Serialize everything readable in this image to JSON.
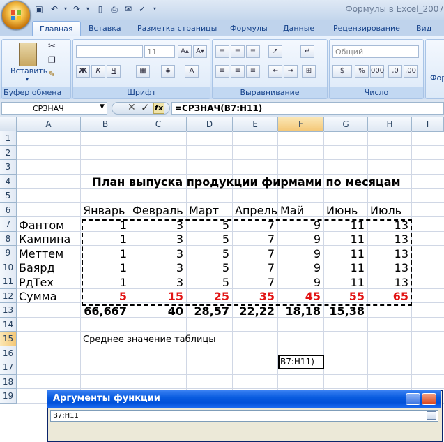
{
  "window": {
    "title": "Формулы в Excel_2007"
  },
  "tabs": [
    "Главная",
    "Вставка",
    "Разметка страницы",
    "Формулы",
    "Данные",
    "Рецензирование",
    "Вид"
  ],
  "ribbon": {
    "clipboard": {
      "label": "Буфер обмена",
      "paste": "Вставить"
    },
    "font": {
      "label": "Шрифт",
      "size": "11",
      "bold": "Ж",
      "italic": "К",
      "underline": "Ч"
    },
    "alignment": {
      "label": "Выравнивание"
    },
    "number": {
      "label": "Число",
      "format": "Общий"
    },
    "styles": {
      "label": "Фор"
    }
  },
  "formula_bar": {
    "name_box": "СРЗНАЧ",
    "fx": "fx",
    "formula": "=СРЗНАЧ(B7:H11)"
  },
  "columns": [
    "A",
    "B",
    "C",
    "D",
    "E",
    "F",
    "G",
    "H",
    "I"
  ],
  "rows": [
    "1",
    "2",
    "3",
    "4",
    "5",
    "6",
    "7",
    "8",
    "9",
    "10",
    "11",
    "12",
    "13",
    "14",
    "15",
    "16",
    "17",
    "18",
    "19"
  ],
  "sheet": {
    "title": "План выпуска продукции фирмами по месяцам",
    "months": [
      "Январь",
      "Февраль",
      "Март",
      "Апрель",
      "Май",
      "Июнь",
      "Июль"
    ],
    "firms": [
      "Фантом",
      "Кампина",
      "Меттем",
      "Баярд",
      "РдТех"
    ],
    "values": [
      [
        "1",
        "3",
        "5",
        "7",
        "9",
        "11",
        "13"
      ],
      [
        "1",
        "3",
        "5",
        "7",
        "9",
        "11",
        "13"
      ],
      [
        "1",
        "3",
        "5",
        "7",
        "9",
        "11",
        "13"
      ],
      [
        "1",
        "3",
        "5",
        "7",
        "9",
        "11",
        "13"
      ],
      [
        "1",
        "3",
        "5",
        "7",
        "9",
        "11",
        "13"
      ]
    ],
    "sum_label": "Сумма",
    "sums": [
      "5",
      "15",
      "25",
      "35",
      "45",
      "55",
      "65"
    ],
    "row13": [
      "66,667",
      "40",
      "28,57",
      "22,22",
      "18,18",
      "15,38"
    ],
    "avg_label": "Среднее значение таблицы",
    "active_cell": "B7:H11)"
  },
  "dialog": {
    "title": "Аргументы функции",
    "input": "B7:H11"
  },
  "colors": {
    "title_blue": "#15428b",
    "red": "#e21414",
    "dialog_blue": "#0a5ce0"
  }
}
